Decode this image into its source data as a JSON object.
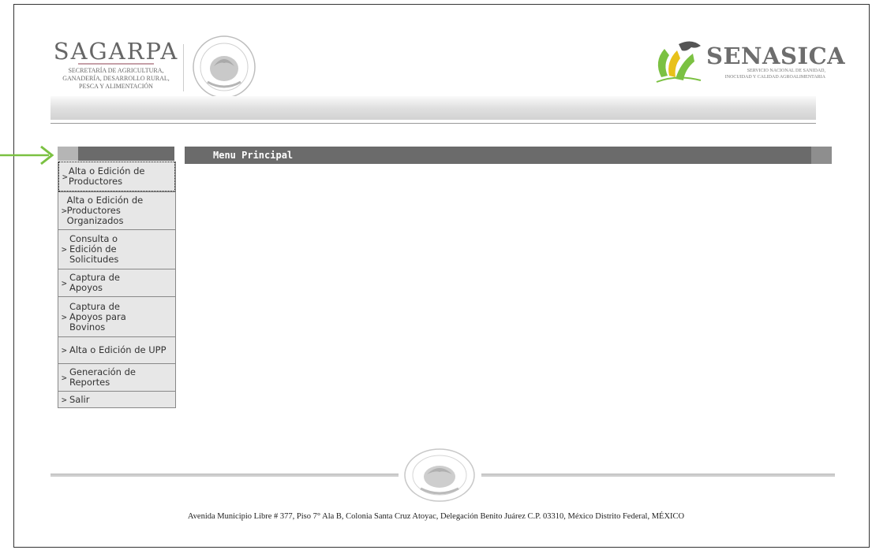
{
  "header": {
    "sagarpa_title": "SAGARPA",
    "sagarpa_sub": [
      "SECRETARÍA DE AGRICULTURA,",
      "GANADERÍA, DESARROLLO RURAL,",
      "PESCA Y ALIMENTACIÓN"
    ],
    "senasica_title": "SENASICA",
    "senasica_sub": [
      "SERVICIO NACIONAL DE SANIDAD,",
      "INOCUIDAD Y CALIDAD AGROALIMENTARIA"
    ]
  },
  "main": {
    "title": "Menu Principal"
  },
  "sidebar": {
    "items": [
      {
        "label": "Alta o Edición de Productores"
      },
      {
        "label": "Alta o Edición de Productores Organizados"
      },
      {
        "label": "Consulta o Edición de Solicitudes"
      },
      {
        "label": "Captura de Apoyos"
      },
      {
        "label": "Captura de Apoyos para Bovinos"
      },
      {
        "label": "Alta o Edición de UPP"
      },
      {
        "label": "Generación de Reportes"
      },
      {
        "label": "Salir"
      }
    ]
  },
  "footer": {
    "address": "Avenida Municipio Libre # 377, Piso 7° Ala B, Colonia Santa Cruz Atoyac, Delegación Benito Juárez C.P. 03310, México Distrito Federal, MÉXICO"
  },
  "colors": {
    "arrow": "#7bc142",
    "header_bar": "#6b6b6b",
    "menu_bg": "#e7e7e7"
  },
  "icons": [
    "pointer-arrow-icon",
    "mexico-seal-icon",
    "senasica-logo-icon",
    "chevron-right-icon"
  ]
}
